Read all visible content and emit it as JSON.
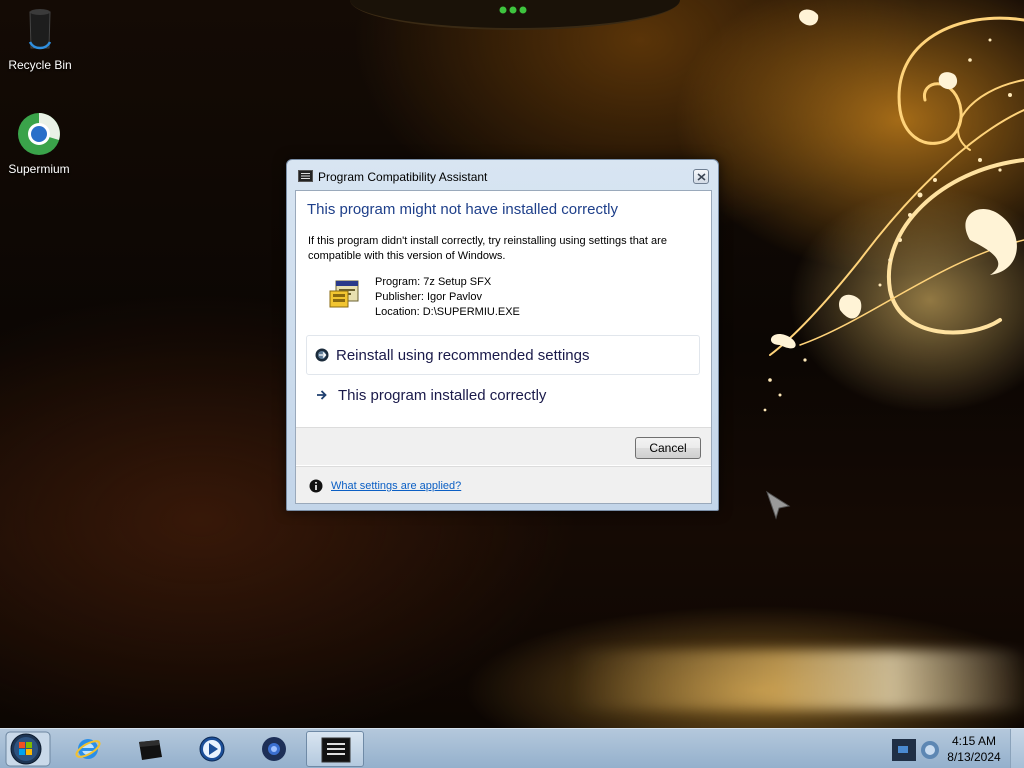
{
  "desktop": {
    "icons": [
      {
        "label": "Recycle Bin",
        "icon": "recycle-bin-icon"
      },
      {
        "label": "Supermium",
        "icon": "supermium-icon"
      }
    ]
  },
  "dialog": {
    "title": "Program Compatibility Assistant",
    "heading": "This program might not have installed correctly",
    "description": "If this program didn't install correctly, try reinstalling using settings that are compatible with this version of Windows.",
    "program_line": "Program: 7z Setup SFX",
    "publisher_line": "Publisher: Igor Pavlov",
    "location_line": "Location: D:\\SUPERMIU.EXE",
    "option_reinstall": "Reinstall using recommended settings",
    "option_installed_correctly": "This program installed correctly",
    "cancel_label": "Cancel",
    "help_link": "What settings are applied?"
  },
  "taskbar": {
    "items": [
      {
        "name": "internet-explorer",
        "icon": "internet-explorer-icon"
      },
      {
        "name": "recycle-bin",
        "icon": "recycle-bin-icon"
      },
      {
        "name": "media-player",
        "icon": "media-player-icon"
      },
      {
        "name": "supermium",
        "icon": "supermium-icon"
      },
      {
        "name": "program-window",
        "icon": "window-icon",
        "active": true
      }
    ],
    "clock": {
      "time": "4:15 AM",
      "date": "8/13/2024"
    }
  },
  "colors": {
    "heading": "#1e3f8a",
    "link": "#0b5fc4",
    "taskbar": "#a4bcd4"
  }
}
